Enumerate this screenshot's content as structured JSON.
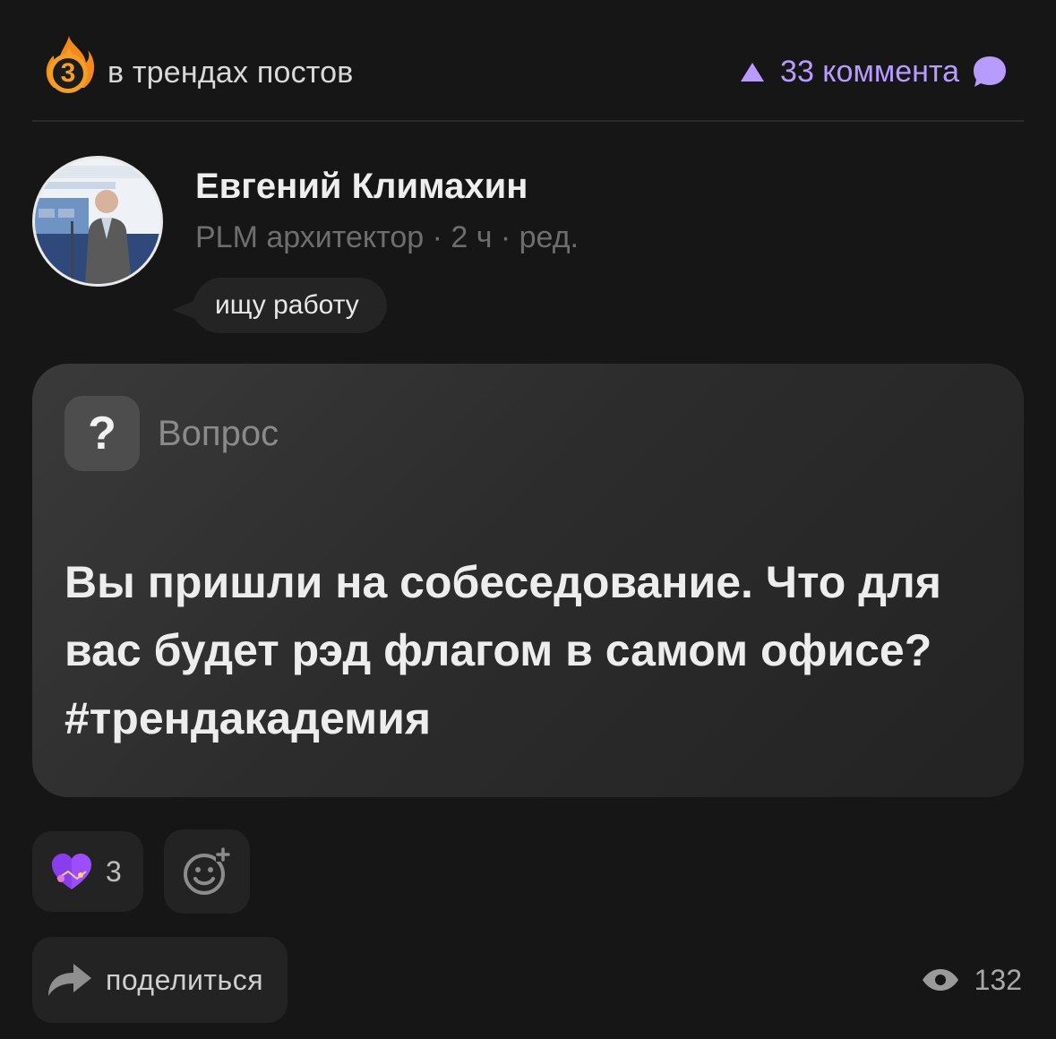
{
  "header": {
    "trend_rank": "3",
    "trend_label": "в трендах постов",
    "comments_label": "33 коммента",
    "accent_color": "#b79bff"
  },
  "author": {
    "name": "Евгений Климахин",
    "meta": "PLM архитектор · 2 ч · ред.",
    "status": "ищу работу"
  },
  "post": {
    "type_icon": "question-icon",
    "type_icon_glyph": "?",
    "type_label": "Вопрос",
    "text": "Вы пришли на собеседование. Что для вас будет рэд флагом в самом офисе? #трендакадемия"
  },
  "reactions": {
    "heart_count": "3"
  },
  "footer": {
    "share_label": "поделиться",
    "views": "132"
  }
}
